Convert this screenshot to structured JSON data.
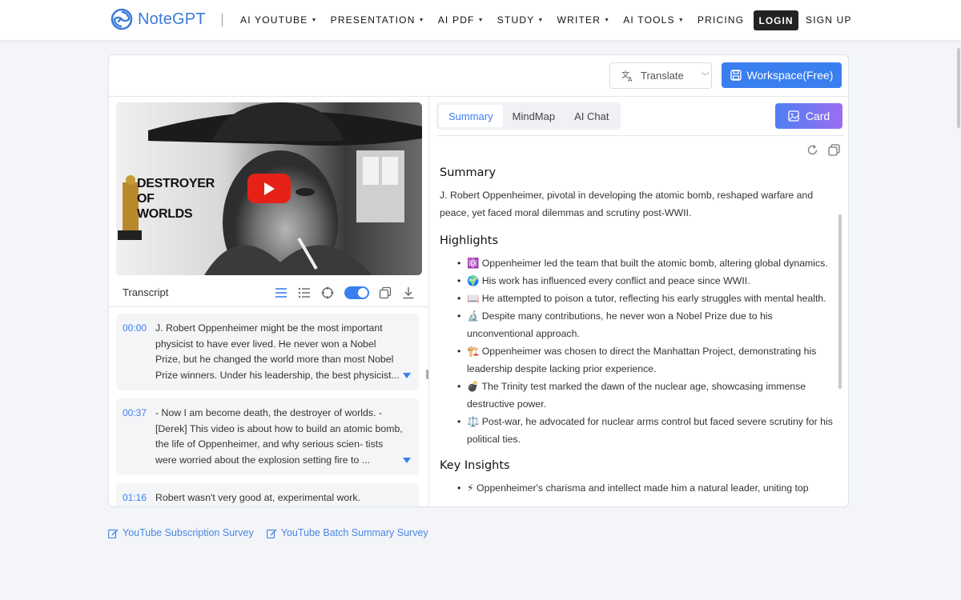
{
  "nav": {
    "logo_text": "NoteGPT",
    "items": [
      {
        "label": "AI YOUTUBE",
        "dropdown": true
      },
      {
        "label": "PRESENTATION",
        "dropdown": true
      },
      {
        "label": "AI PDF",
        "dropdown": true
      },
      {
        "label": "STUDY",
        "dropdown": true
      },
      {
        "label": "WRITER",
        "dropdown": true
      },
      {
        "label": "AI TOOLS",
        "dropdown": true
      },
      {
        "label": "PRICING",
        "dropdown": false
      }
    ],
    "login": "LOGIN",
    "signup": "SIGN UP"
  },
  "toolbar": {
    "translate_label": "Translate",
    "workspace_label": "Workspace(Free)"
  },
  "video": {
    "overlay_line1": "DESTROYER",
    "overlay_line2": "OF",
    "overlay_line3": "WORLDS"
  },
  "transcript": {
    "label": "Transcript",
    "items": [
      {
        "time": "00:00",
        "text": "J. Robert Oppenheimer might be the most important physicist to have ever lived. He never won a Nobel Prize, but he changed the world more than most Nobel Prize winners. Under his leadership, the best physicist..."
      },
      {
        "time": "00:37",
        "text": "- Now I am become death, the destroyer of worlds. - [Derek] This video is about how to build an atomic bomb, the life of Oppenheimer, and why serious scien- tists were worried about the explosion setting fire to ..."
      },
      {
        "time": "01:16",
        "text": "Robert wasn't very good at, experimental work."
      }
    ]
  },
  "tabs": [
    {
      "label": "Summary",
      "active": true
    },
    {
      "label": "MindMap",
      "active": false
    },
    {
      "label": "AI Chat",
      "active": false
    }
  ],
  "card_label": "Card",
  "summary": {
    "title": "Summary",
    "text": "J. Robert Oppenheimer, pivotal in developing the atomic bomb, reshaped warfare and peace, yet faced moral dilemmas and scrutiny post-WWII.",
    "highlights_title": "Highlights",
    "highlights": [
      "⚛️ Oppenheimer led the team that built the atomic bomb, altering global dynamics.",
      "🌍 His work has influenced every conflict and peace since WWII.",
      "📖 He attempted to poison a tutor, reflecting his early struggles with mental health.",
      "🔬 Despite many contributions, he never won a Nobel Prize due to his unconventional approach.",
      "🏗️ Oppenheimer was chosen to direct the Manhattan Project, demonstrating his leadership despite lacking prior experience.",
      "💣 The Trinity test marked the dawn of the nuclear age, showcasing immense destructive power.",
      "⚖️ Post-war, he advocated for nuclear arms control but faced severe scrutiny for his political ties."
    ],
    "insights_title": "Key Insights",
    "insights": [
      "⚡ Oppenheimer's charisma and intellect made him a natural leader, uniting top"
    ]
  },
  "bottom_links": [
    {
      "label": "YouTube Subscription Survey"
    },
    {
      "label": "YouTube Batch Summary Survey"
    }
  ],
  "colors": {
    "accent": "#3a7ff0",
    "link": "#4a86e0",
    "logo": "#3b7bd8"
  }
}
